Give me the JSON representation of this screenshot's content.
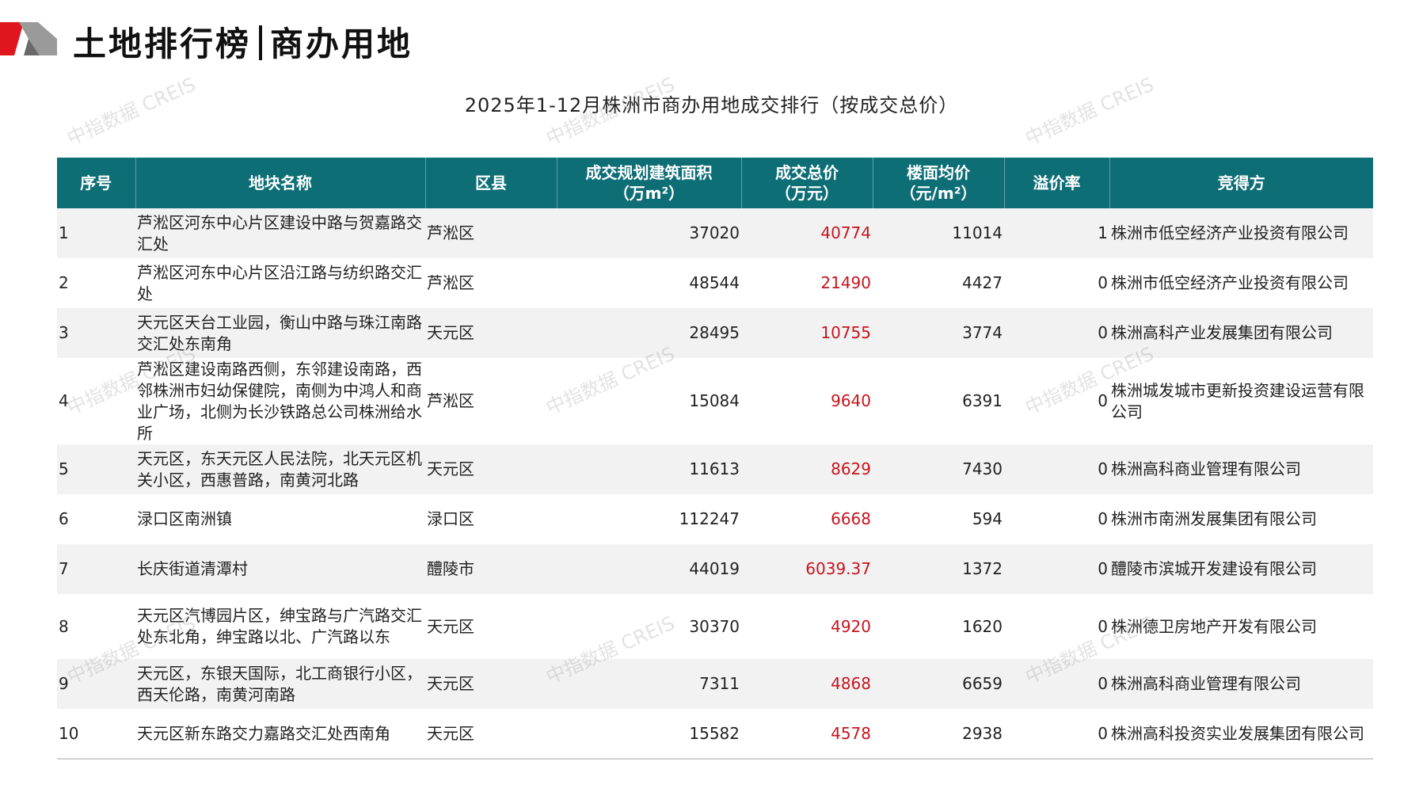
{
  "header": {
    "title_left": "土地排行榜",
    "title_right": "商办用地",
    "subtitle": "2025年1-12月株洲市商办用地成交排行（按成交总价）"
  },
  "watermark_text": "中指数据 CREIS",
  "colors": {
    "header_bg": "#0e6e76",
    "price_red": "#c8141e",
    "accent_red": "#e0161e"
  },
  "table": {
    "columns": [
      {
        "label": "序号",
        "unit": ""
      },
      {
        "label": "地块名称",
        "unit": ""
      },
      {
        "label": "区县",
        "unit": ""
      },
      {
        "label": "成交规划建筑面积",
        "unit": "（万m²）"
      },
      {
        "label": "成交总价",
        "unit": "（万元）"
      },
      {
        "label": "楼面均价",
        "unit": "（元/m²）"
      },
      {
        "label": "溢价率",
        "unit": ""
      },
      {
        "label": "竞得方",
        "unit": ""
      }
    ],
    "rows": [
      {
        "rank": "1",
        "name": "芦淞区河东中心片区建设中路与贺嘉路交汇处",
        "district": "芦淞区",
        "area": "37020",
        "total": "40774",
        "unit_price": "11014",
        "premium": "1",
        "buyer": "株洲市低空经济产业投资有限公司"
      },
      {
        "rank": "2",
        "name": "芦淞区河东中心片区沿江路与纺织路交汇处",
        "district": "芦淞区",
        "area": "48544",
        "total": "21490",
        "unit_price": "4427",
        "premium": "0",
        "buyer": "株洲市低空经济产业投资有限公司"
      },
      {
        "rank": "3",
        "name": "天元区天台工业园，衡山中路与珠江南路交汇处东南角",
        "district": "天元区",
        "area": "28495",
        "total": "10755",
        "unit_price": "3774",
        "premium": "0",
        "buyer": "株洲高科产业发展集团有限公司"
      },
      {
        "rank": "4",
        "name": "芦淞区建设南路西侧，东邻建设南路，西邻株洲市妇幼保健院，南侧为中鸿人和商业广场，北侧为长沙铁路总公司株洲给水所",
        "district": "芦淞区",
        "area": "15084",
        "total": "9640",
        "unit_price": "6391",
        "premium": "0",
        "buyer": "株洲城发城市更新投资建设运营有限公司"
      },
      {
        "rank": "5",
        "name": "天元区，东天元区人民法院，北天元区机关小区，西惠普路，南黄河北路",
        "district": "天元区",
        "area": "11613",
        "total": "8629",
        "unit_price": "7430",
        "premium": "0",
        "buyer": "株洲高科商业管理有限公司"
      },
      {
        "rank": "6",
        "name": "渌口区南洲镇",
        "district": "渌口区",
        "area": "112247",
        "total": "6668",
        "unit_price": "594",
        "premium": "0",
        "buyer": "株洲市南洲发展集团有限公司"
      },
      {
        "rank": "7",
        "name": "长庆街道清潭村",
        "district": "醴陵市",
        "area": "44019",
        "total": "6039.37",
        "unit_price": "1372",
        "premium": "0",
        "buyer": "醴陵市滨城开发建设有限公司"
      },
      {
        "rank": "8",
        "name": "天元区汽博园片区，绅宝路与广汽路交汇处东北角，绅宝路以北、广汽路以东",
        "district": "天元区",
        "area": "30370",
        "total": "4920",
        "unit_price": "1620",
        "premium": "0",
        "buyer": "株洲德卫房地产开发有限公司"
      },
      {
        "rank": "9",
        "name": "天元区，东银天国际，北工商银行小区，西天伦路，南黄河南路",
        "district": "天元区",
        "area": "7311",
        "total": "4868",
        "unit_price": "6659",
        "premium": "0",
        "buyer": "株洲高科商业管理有限公司"
      },
      {
        "rank": "10",
        "name": "天元区新东路交力嘉路交汇处西南角",
        "district": "天元区",
        "area": "15582",
        "total": "4578",
        "unit_price": "2938",
        "premium": "0",
        "buyer": "株洲高科投资实业发展集团有限公司"
      }
    ]
  }
}
